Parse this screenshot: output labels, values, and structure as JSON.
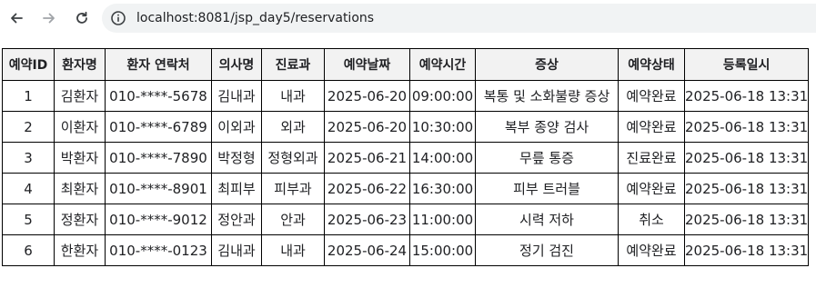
{
  "browser": {
    "url": "localhost:8081/jsp_day5/reservations"
  },
  "table": {
    "headers": [
      "예약ID",
      "환자명",
      "환자 연락처",
      "의사명",
      "진료과",
      "예약날짜",
      "예약시간",
      "증상",
      "예약상태",
      "등록일시"
    ],
    "rows": [
      [
        "1",
        "김환자",
        "010-****-5678",
        "김내과",
        "내과",
        "2025-06-20",
        "09:00:00",
        "복통 및 소화불량 증상",
        "예약완료",
        "2025-06-18 13:31"
      ],
      [
        "2",
        "이환자",
        "010-****-6789",
        "이외과",
        "외과",
        "2025-06-20",
        "10:30:00",
        "복부 종양 검사",
        "예약완료",
        "2025-06-18 13:31"
      ],
      [
        "3",
        "박환자",
        "010-****-7890",
        "박정형",
        "정형외과",
        "2025-06-21",
        "14:00:00",
        "무릎 통증",
        "진료완료",
        "2025-06-18 13:31"
      ],
      [
        "4",
        "최환자",
        "010-****-8901",
        "최피부",
        "피부과",
        "2025-06-22",
        "16:30:00",
        "피부 트러블",
        "예약완료",
        "2025-06-18 13:31"
      ],
      [
        "5",
        "정환자",
        "010-****-9012",
        "정안과",
        "안과",
        "2025-06-23",
        "11:00:00",
        "시력 저하",
        "취소",
        "2025-06-18 13:31"
      ],
      [
        "6",
        "한환자",
        "010-****-0123",
        "김내과",
        "내과",
        "2025-06-24",
        "15:00:00",
        "정기 검진",
        "예약완료",
        "2025-06-18 13:31"
      ]
    ]
  }
}
